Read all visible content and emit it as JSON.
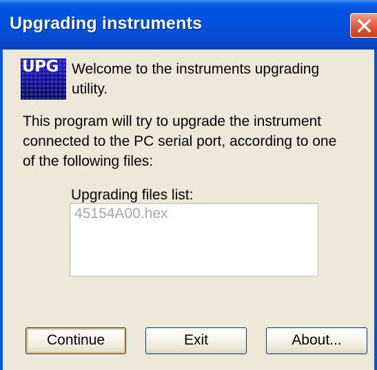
{
  "window": {
    "title": "Upgrading instruments",
    "close_icon": "close-icon"
  },
  "logo": {
    "text": "UPG"
  },
  "content": {
    "welcome_text": "Welcome to the instruments upgrading utility.",
    "description": "This program will try to upgrade the instrument connected to the PC serial port, according to one of the following files:",
    "list_label": "Upgrading files list:",
    "files": [
      "45154A00.hex"
    ]
  },
  "buttons": {
    "continue_label": "Continue",
    "exit_label": "Exit",
    "about_label": "About..."
  },
  "colors": {
    "titlebar": "#0054E3",
    "dialog_bg": "#ECE9D8",
    "close_button": "#D94E2C",
    "button_border": "#003C74",
    "disabled_text": "#A8A8A8"
  }
}
